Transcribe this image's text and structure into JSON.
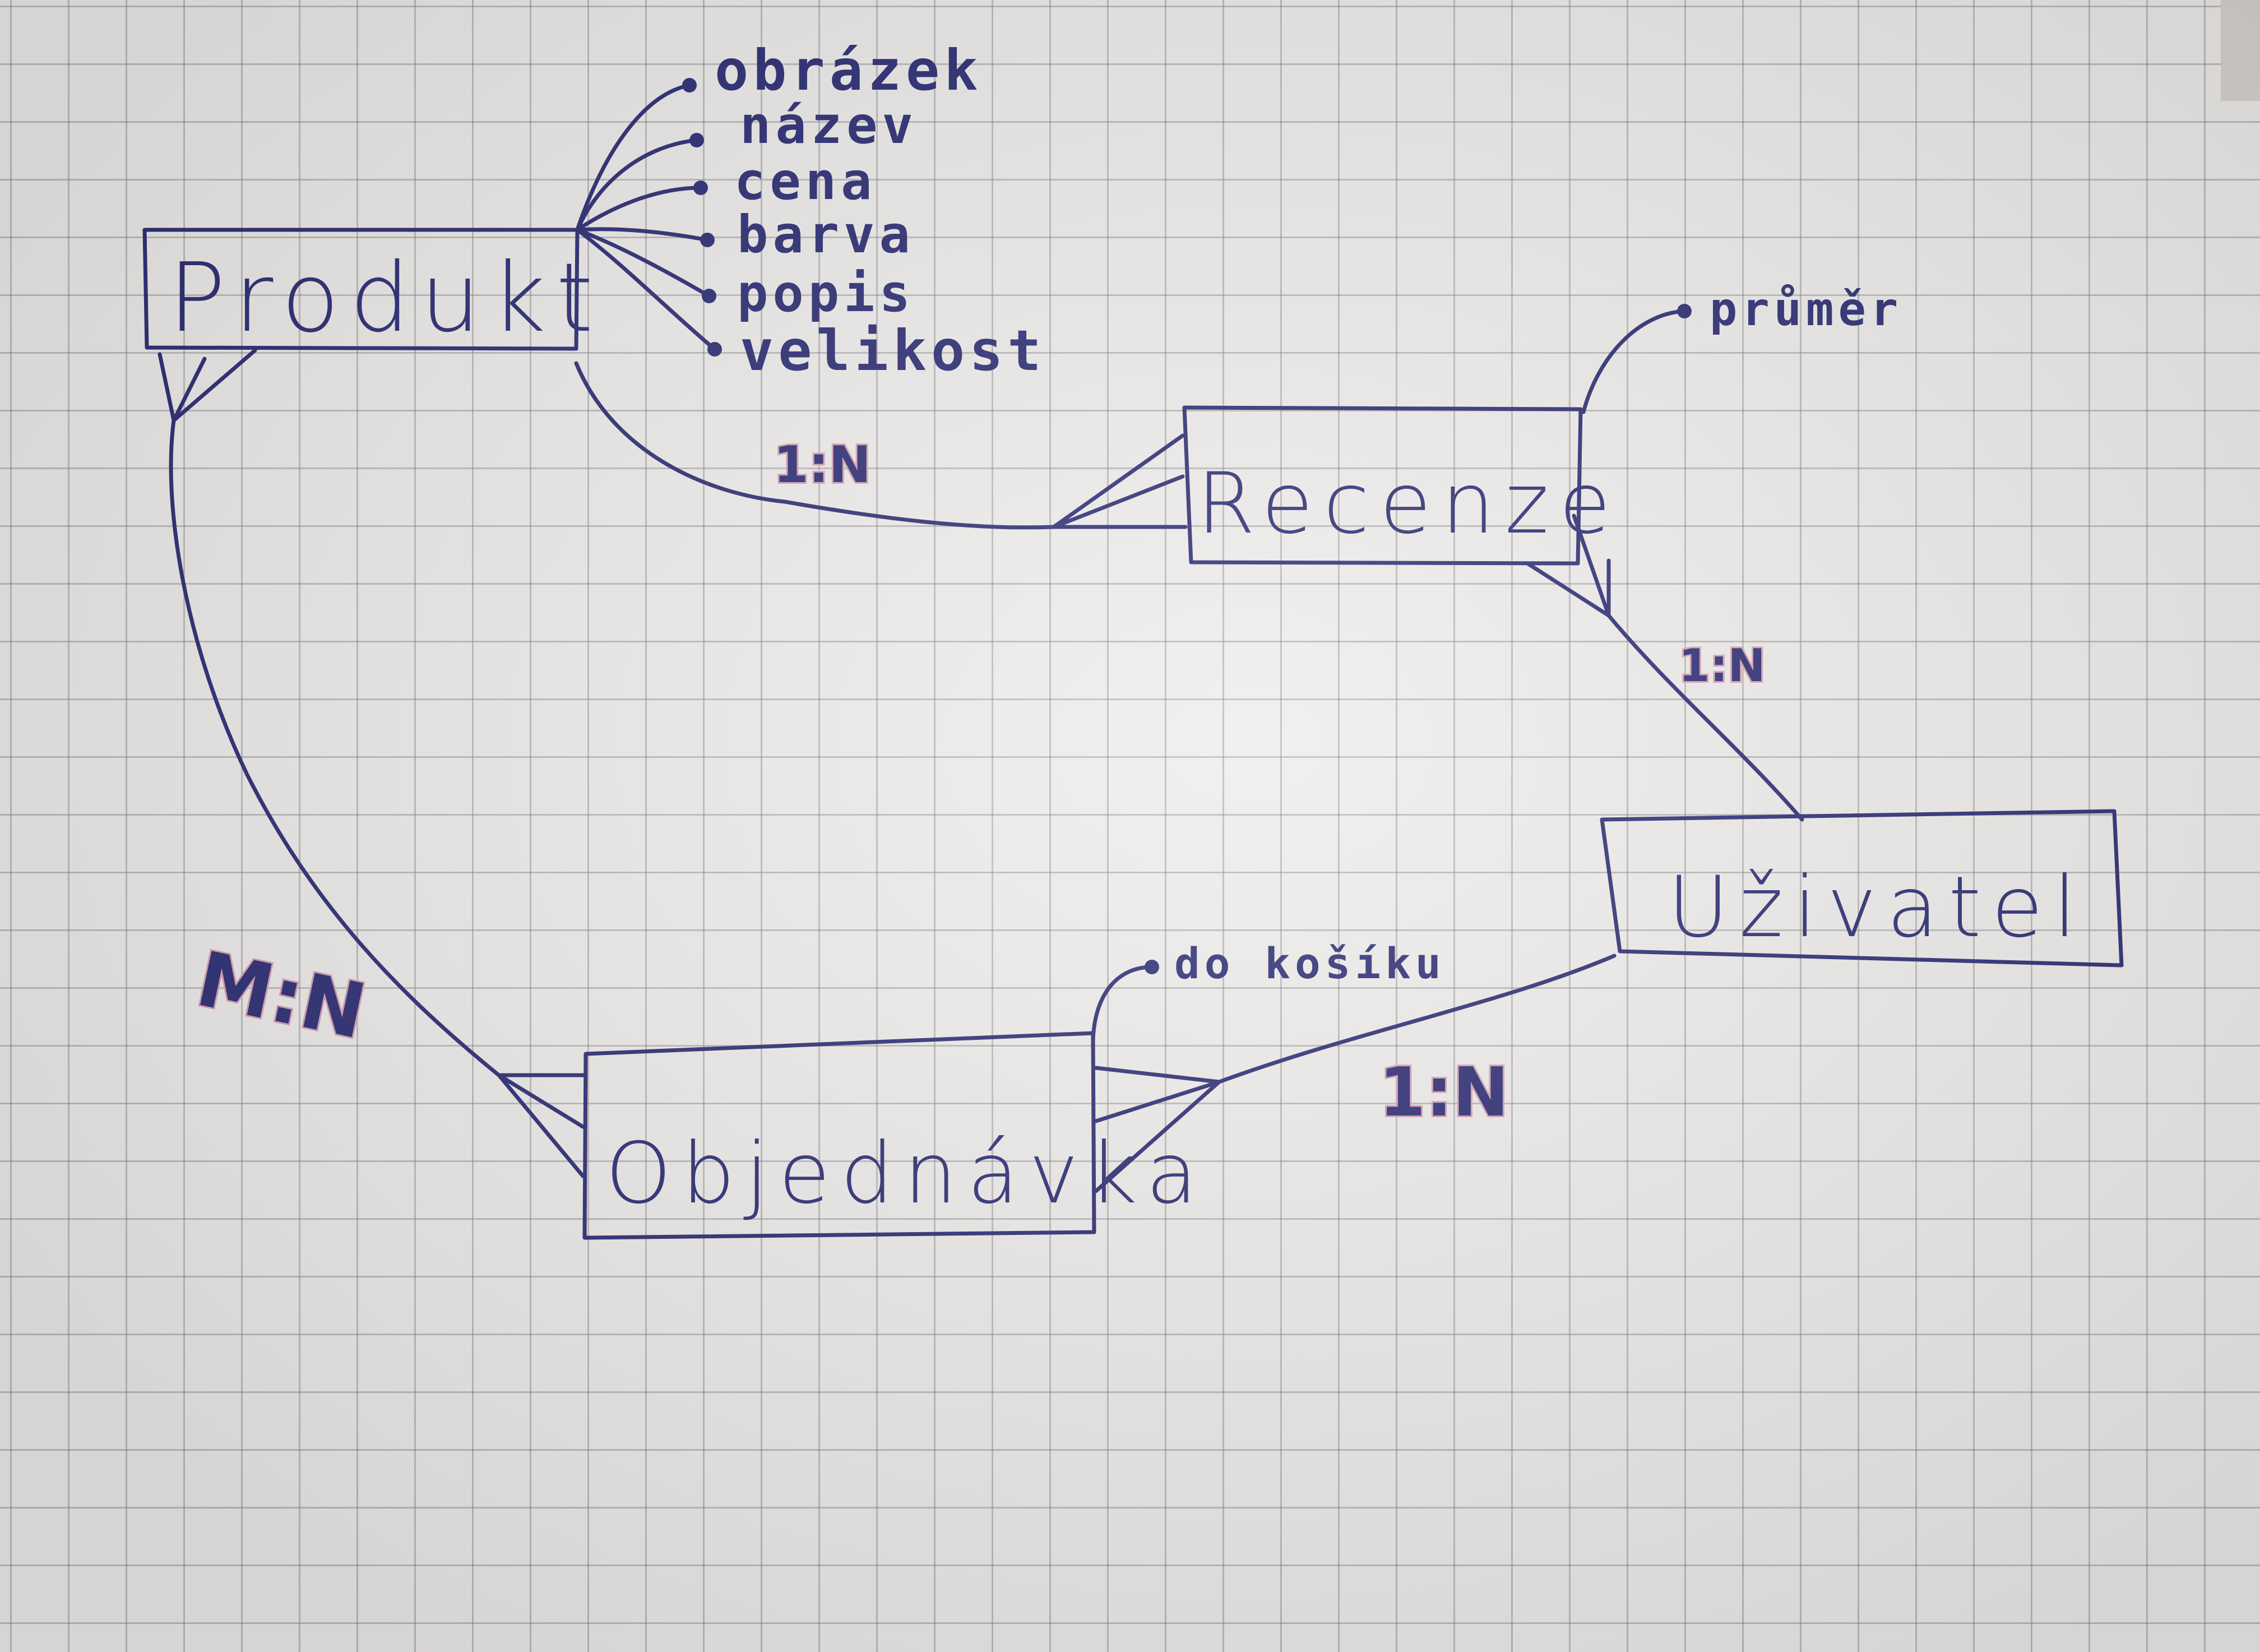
{
  "entities": {
    "produkt": "Produkt",
    "recenze": "Recenze",
    "uzivatel": "Uživatel",
    "objednavka": "Objednávka"
  },
  "produkt_attributes": [
    "obrázek",
    "název",
    "cena",
    "barva",
    "popis",
    "velikost"
  ],
  "recenze_attribute": "průměr",
  "objednavka_attribute": "do košíku",
  "cardinalities": {
    "produkt_recenze": "1:N",
    "recenze_uzivatel": "1:N",
    "produkt_objednavka": "M:N",
    "uzivatel_objednavka": "1:N"
  },
  "colors": {
    "ink": "#2b2c74",
    "highlight": "#d9a0b4"
  }
}
